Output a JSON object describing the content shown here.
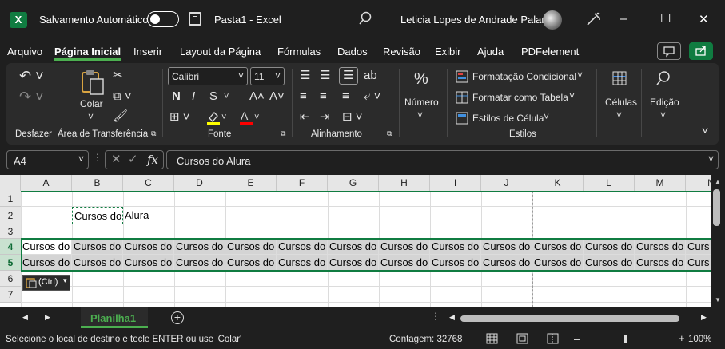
{
  "titlebar": {
    "app_letter": "X",
    "autosave_label": "Salvamento Automático",
    "save_icon": "save-icon",
    "document_title": "Pasta1  -  Excel",
    "user_name": "Leticia Lopes de Andrade Palaro",
    "minimize": "–",
    "maximize": "☐",
    "close": "✕"
  },
  "menu": {
    "items": [
      "Arquivo",
      "Página Inicial",
      "Inserir",
      "Layout da Página",
      "Fórmulas",
      "Dados",
      "Revisão",
      "Exibir",
      "Ajuda",
      "PDFelement"
    ],
    "active": "Página Inicial"
  },
  "ribbon": {
    "undo_group_label": "Desfazer",
    "clipboard": {
      "paste_label": "Colar",
      "group_label": "Área de Transferência"
    },
    "font": {
      "family": "Calibri",
      "size": "11",
      "bold": "N",
      "italic": "I",
      "underline": "S",
      "grow": "A˄",
      "shrink": "A˅",
      "group_label": "Fonte"
    },
    "alignment": {
      "group_label": "Alinhamento"
    },
    "number": {
      "label": "Número"
    },
    "styles": {
      "conditional": "Formatação Condicional",
      "table": "Formatar como Tabela",
      "cell_styles": "Estilos de Célula",
      "group_label": "Estilos"
    },
    "cells_label": "Células",
    "editing_label": "Edição",
    "colors": {
      "highlight": "#ffff00",
      "font_color": "#ff0000",
      "accent": "#107c41"
    }
  },
  "formula_bar": {
    "name_box": "A4",
    "fx": "fx",
    "content": "Cursos do Alura"
  },
  "grid": {
    "columns": [
      "A",
      "B",
      "C",
      "D",
      "E",
      "F",
      "G",
      "H",
      "I",
      "J",
      "K",
      "L",
      "M",
      "N"
    ],
    "rows": [
      "1",
      "2",
      "3",
      "4",
      "5",
      "6",
      "7"
    ],
    "b2_text_left": "Cursos do",
    "b2_text_right": "Alura",
    "row_cell_text": "Cursos do",
    "row_cell_text_clipped": "Curs",
    "paste_options": "(Ctrl)"
  },
  "sheets": {
    "tabs": [
      "Planilha1"
    ],
    "add": "+"
  },
  "status": {
    "message": "Selecione o local de destino e tecle ENTER ou use 'Colar'",
    "count": "Contagem: 32768",
    "zoom": "100%",
    "zoom_minus": "–",
    "zoom_plus": "+"
  }
}
